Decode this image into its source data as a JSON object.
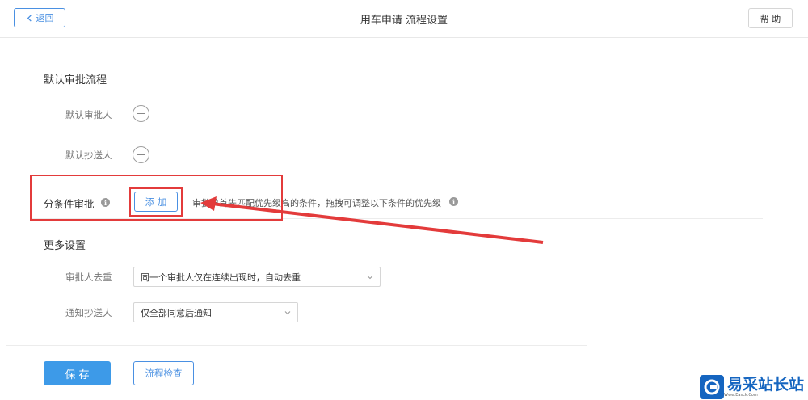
{
  "header": {
    "back_label": "返回",
    "title": "用车申请 流程设置",
    "help_label": "帮 助"
  },
  "default_flow": {
    "title": "默认审批流程",
    "approver_label": "默认审批人",
    "cc_label": "默认抄送人"
  },
  "conditional": {
    "label": "分条件审批",
    "add_label": "添 加",
    "hint": "审批单首先匹配优先级高的条件，拖拽可调整以下条件的优先级"
  },
  "more_settings": {
    "title": "更多设置",
    "dedupe_label": "审批人去重",
    "dedupe_value": "同一个审批人仅在连续出现时，自动去重",
    "notify_label": "通知抄送人",
    "notify_value": "仅全部同意后通知"
  },
  "footer": {
    "save_label": "保 存",
    "check_label": "流程检查"
  },
  "watermark": {
    "text": "易采站长站",
    "sub": "Www.Easck.Com"
  },
  "colors": {
    "accent": "#4a90e2",
    "primary_button": "#3d9ae8",
    "highlight": "#e33b3b"
  },
  "icons": [
    "chevron-left-icon",
    "plus-icon",
    "info-icon",
    "chevron-down-icon",
    "arrow-annotation"
  ]
}
